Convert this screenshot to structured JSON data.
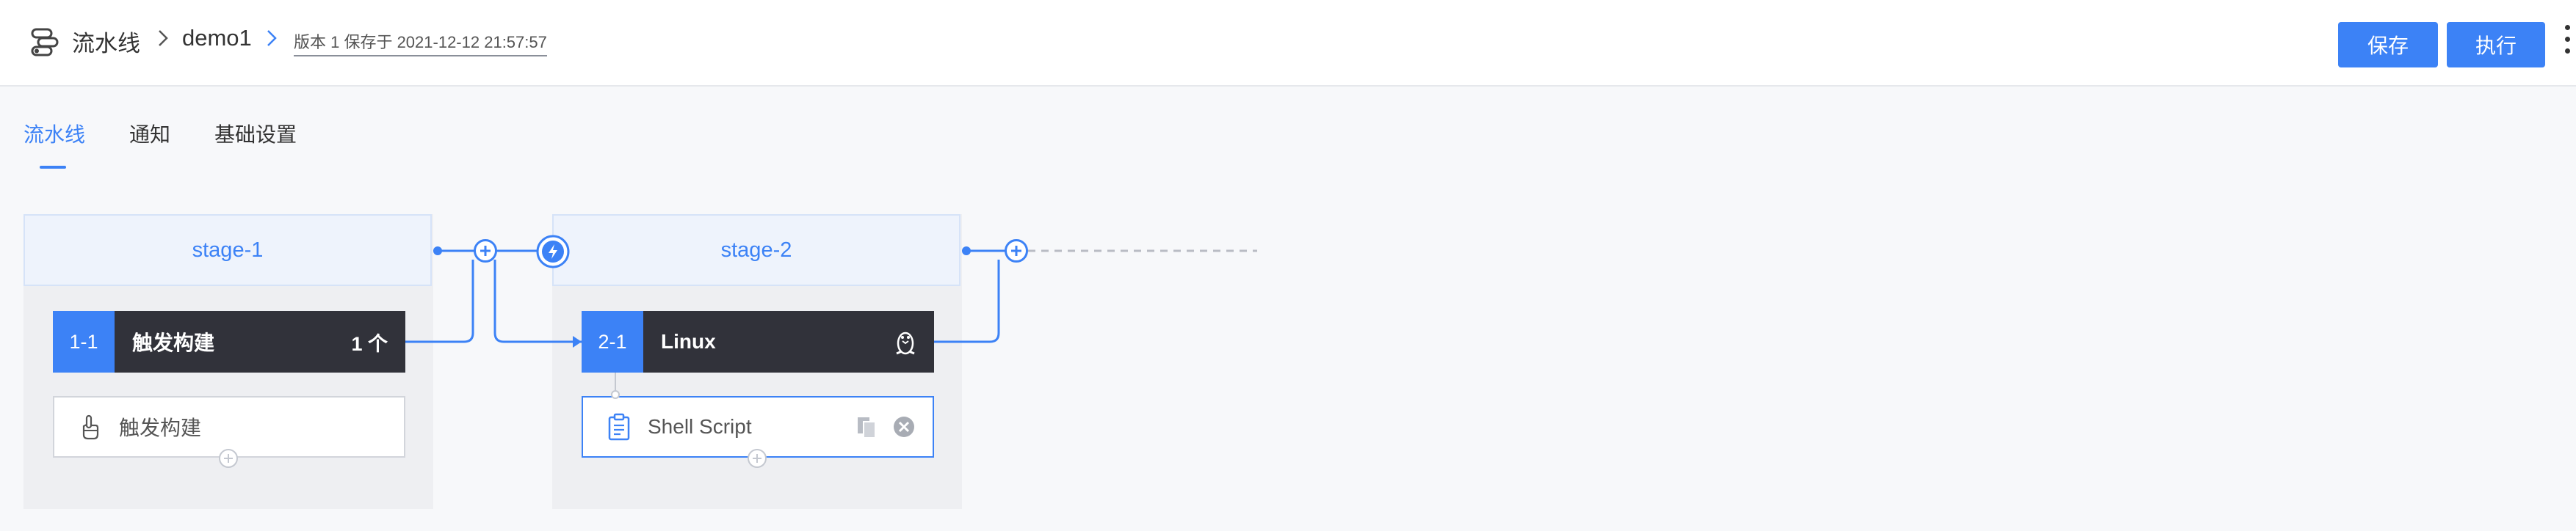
{
  "header": {
    "breadcrumb_root": "流水线",
    "pipeline_name": "demo1",
    "version_info": "版本 1 保存于 2021-12-12 21:57:57",
    "save_label": "保存",
    "run_label": "执行"
  },
  "tabs": [
    {
      "label": "流水线",
      "active": true
    },
    {
      "label": "通知",
      "active": false
    },
    {
      "label": "基础设置",
      "active": false
    }
  ],
  "stages": [
    {
      "name": "stage-1",
      "job": {
        "id": "1-1",
        "title": "触发构建",
        "count": "1 个"
      },
      "atom": {
        "label": "触发构建",
        "icon": "hand-pointer-icon"
      }
    },
    {
      "name": "stage-2",
      "job": {
        "id": "2-1",
        "title": "Linux",
        "os_icon": "linux-penguin-icon"
      },
      "atom": {
        "label": "Shell Script",
        "icon": "clipboard-icon"
      }
    }
  ],
  "colors": {
    "accent": "#3c82f6",
    "job_header_bg": "#31323a",
    "stage_header_bg": "#eef3fc"
  }
}
